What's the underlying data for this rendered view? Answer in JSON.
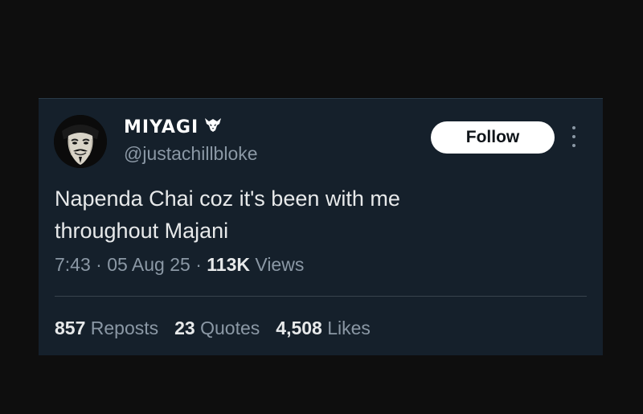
{
  "tweet": {
    "author": {
      "display_name": "MIYAGI",
      "badge_icon": "wolf-emblem-icon",
      "handle": "@justachillbloke",
      "avatar": "guy-fawkes-mask-avatar"
    },
    "follow_label": "Follow",
    "more_icon": "more-options-icon",
    "text_line1": "Napenda Chai coz it's been with me",
    "text_line2": "throughout Majani",
    "time": "7:43",
    "date": "05 Aug 25",
    "views_count": "113K",
    "views_label": "Views",
    "sep": "·",
    "reposts_count": "857",
    "reposts_label": "Reposts",
    "quotes_count": "23",
    "quotes_label": "Quotes",
    "likes_count": "4,508",
    "likes_label": "Likes"
  },
  "colors": {
    "page_background": "#0e0e0e",
    "card_background": "#15202b",
    "primary_text": "#e7e9ea",
    "secondary_text": "#8b98a5",
    "button_background": "#ffffff"
  }
}
